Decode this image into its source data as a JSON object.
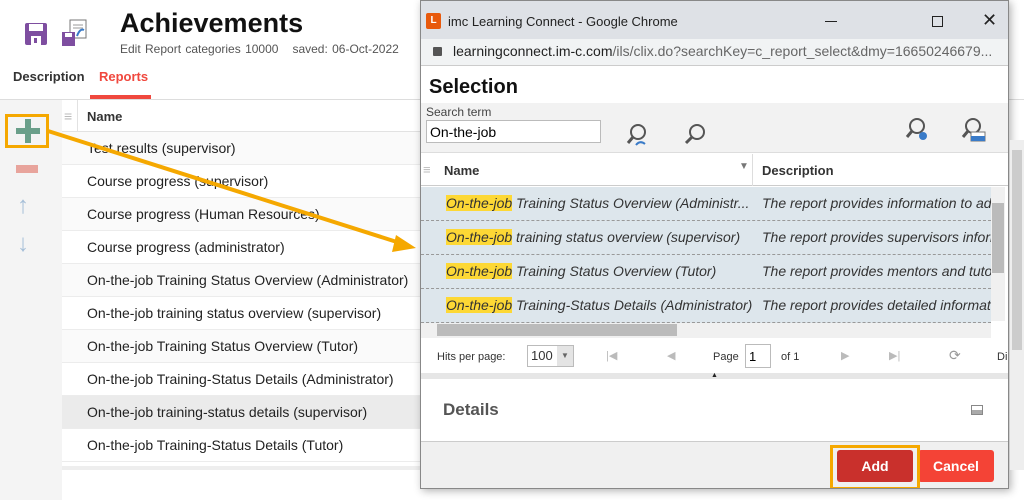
{
  "page": {
    "title": "Achievements",
    "subtitle": "Edit Report categories 10000",
    "saved": "saved: 06-Oct-2022",
    "tabs": [
      {
        "label": "Description"
      },
      {
        "label": "Reports"
      }
    ],
    "grid": {
      "header": "Name",
      "rows": [
        "Test results (supervisor)",
        "Course progress (supervisor)",
        "Course progress (Human Resources)",
        "Course progress (administrator)",
        "On-the-job Training Status Overview (Administrator)",
        "On-the-job training status overview (supervisor)",
        "On-the-job Training Status Overview (Tutor)",
        "On-the-job Training-Status Details (Administrator)",
        "On-the-job training-status details (supervisor)",
        "On-the-job Training-Status Details (Tutor)"
      ]
    }
  },
  "popup": {
    "window_title": "imc Learning Connect - Google Chrome",
    "app_icon_letter": "L",
    "url_host": "learningconnect.im-c.com",
    "url_path": "/ils/clix.do?searchKey=c_report_select&dmy=16650246679...",
    "heading": "Selection",
    "search_label": "Search term",
    "search_value": "On-the-job",
    "columns": [
      "Name",
      "Description"
    ],
    "rows": [
      {
        "match": "On-the-job",
        "name": " Training Status Overview (Administr...",
        "desc": "The report provides information to ad"
      },
      {
        "match": "On-the-job",
        "name": " training status overview (supervisor)",
        "desc": "The report provides supervisors inform"
      },
      {
        "match": "On-the-job",
        "name": " Training Status Overview (Tutor)",
        "desc": "The report provides mentors and tutor"
      },
      {
        "match": "On-the-job",
        "name": " Training-Status Details (Administrator)",
        "desc": "The report provides detailed informati"
      }
    ],
    "pager": {
      "hits_label": "Hits per page:",
      "hits_value": "100",
      "page_label": "Page",
      "page_value": "1",
      "of_label": "of 1",
      "extra": "Di"
    },
    "details_label": "Details",
    "add_label": "Add",
    "cancel_label": "Cancel"
  },
  "colors": {
    "accent": "#f0483e",
    "add": "#c9302c",
    "cancel": "#f44336",
    "highlight": "#f5a800",
    "match": "#fdd835"
  }
}
